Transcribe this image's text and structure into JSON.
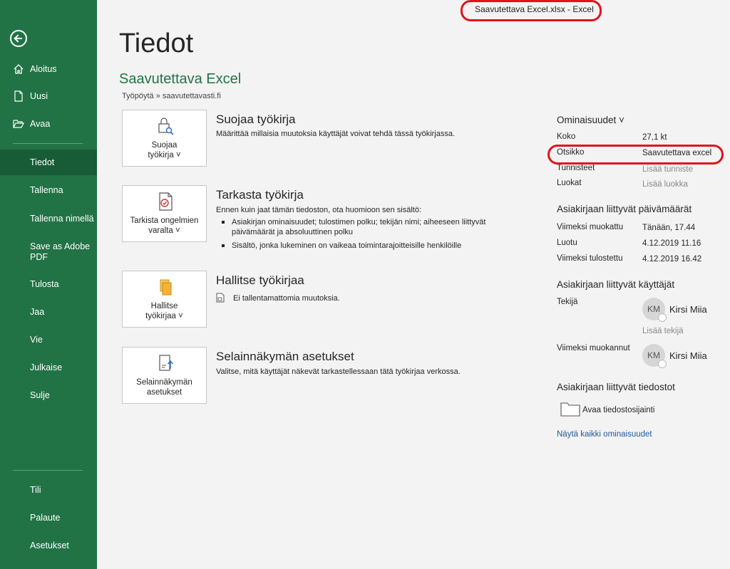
{
  "window": {
    "title": "Saavutettava Excel.xlsx  -  Excel"
  },
  "sidebar": {
    "items": [
      {
        "label": "Aloitus"
      },
      {
        "label": "Uusi"
      },
      {
        "label": "Avaa"
      },
      {
        "label": "Tiedot"
      },
      {
        "label": "Tallenna"
      },
      {
        "label": "Tallenna nimellä"
      },
      {
        "label": "Save as Adobe PDF"
      },
      {
        "label": "Tulosta"
      },
      {
        "label": "Jaa"
      },
      {
        "label": "Vie"
      },
      {
        "label": "Julkaise"
      },
      {
        "label": "Sulje"
      }
    ],
    "bottom": [
      {
        "label": "Tili"
      },
      {
        "label": "Palaute"
      },
      {
        "label": "Asetukset"
      }
    ]
  },
  "main": {
    "page_title": "Tiedot",
    "doc_name": "Saavutettava Excel",
    "doc_path": "Työpöytä » saavutettavasti.fi",
    "sections": [
      {
        "card_label_1": "Suojaa",
        "card_label_2": "työkirja ˅",
        "title": "Suojaa työkirja",
        "desc": "Määrittää millaisia muutoksia käyttäjät voivat tehdä tässä työkirjassa."
      },
      {
        "card_label_1": "Tarkista ongelmien",
        "card_label_2": "varalta ˅",
        "title": "Tarkasta työkirja",
        "desc": "Ennen kuin jaat tämän tiedoston, ota huomioon sen sisältö:",
        "bullets": [
          "Asiakirjan ominaisuudet; tulostimen polku; tekijän nimi; aiheeseen liittyvät päivämäärät ja absoluuttinen polku",
          "Sisältö, jonka lukeminen on vaikeaa toimintarajoitteisille henkilöille"
        ]
      },
      {
        "card_label_1": "Hallitse",
        "card_label_2": "työkirjaa ˅",
        "title": "Hallitse työkirjaa",
        "desc": "Ei tallentamattomia muutoksia."
      },
      {
        "card_label_1": "Selainnäkymän",
        "card_label_2": "asetukset",
        "title": "Selainnäkymän asetukset",
        "desc": "Valitse, mitä käyttäjät näkevät tarkastellessaan tätä työkirjaa verkossa."
      }
    ]
  },
  "properties": {
    "heading": "Ominaisuudet ˅",
    "rows": [
      {
        "key": "Koko",
        "value": "27,1 kt"
      },
      {
        "key": "Otsikko",
        "value": "Saavutettava excel"
      },
      {
        "key": "Tunnisteet",
        "value": "Lisää tunniste"
      },
      {
        "key": "Luokat",
        "value": "Lisää luokka"
      }
    ],
    "dates_heading": "Asiakirjaan liittyvät päivämäärät",
    "dates": [
      {
        "key": "Viimeksi muokattu",
        "value": "Tänään, 17.44"
      },
      {
        "key": "Luotu",
        "value": "4.12.2019 11.16"
      },
      {
        "key": "Viimeksi tulostettu",
        "value": "4.12.2019 16.42"
      }
    ],
    "users_heading": "Asiakirjaan liittyvät käyttäjät",
    "author_label": "Tekijä",
    "author_initials": "KM",
    "author_name": "Kirsi Miia",
    "add_author": "Lisää tekijä",
    "modified_by_label": "Viimeksi muokannut",
    "modified_initials": "KM",
    "modified_name": "Kirsi Miia",
    "files_heading": "Asiakirjaan liittyvät tiedostot",
    "open_location": "Avaa tiedostosijainti",
    "show_all": "Näytä kaikki ominaisuudet"
  },
  "colors": {
    "accent": "#217346",
    "highlight": "#e0141d"
  }
}
